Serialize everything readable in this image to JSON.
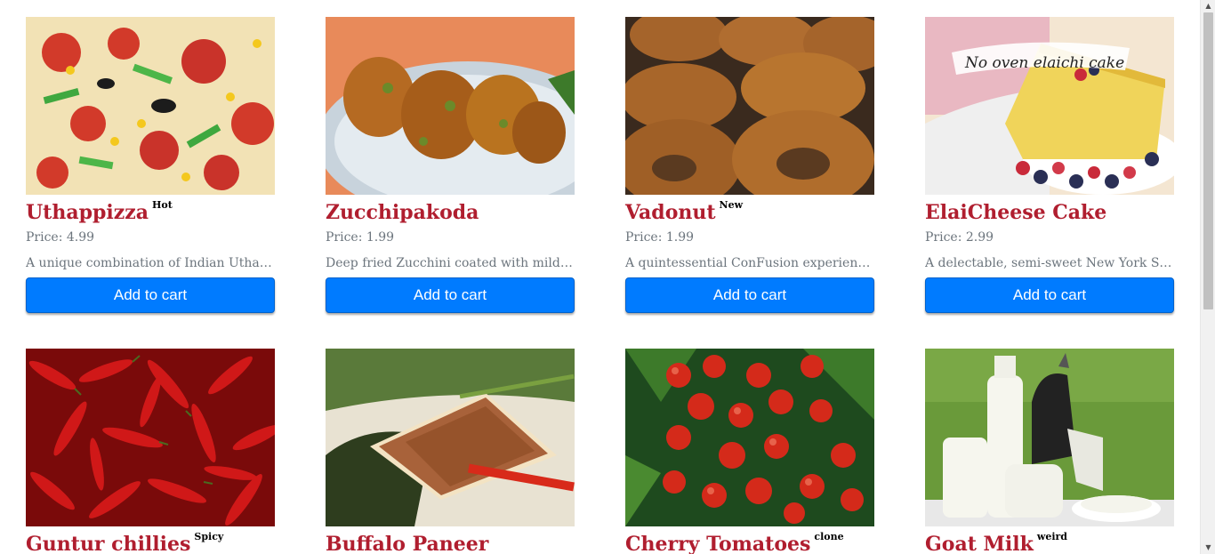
{
  "colors": {
    "title": "#b01e2f",
    "button": "#007bff",
    "muted": "#6c757d"
  },
  "products": [
    {
      "name": "Uthappizza",
      "badge": "Hot",
      "price": "Price: 4.99",
      "description": "A unique combination of Indian Uthappam (pancake) and Italian pizza",
      "button": "Add to cart",
      "image": "pizza"
    },
    {
      "name": "Zucchipakoda",
      "badge": "",
      "price": "Price: 1.99",
      "description": "Deep fried Zucchini coated with mildly spiced Chickpea flour batter",
      "button": "Add to cart",
      "image": "pakoda"
    },
    {
      "name": "Vadonut",
      "badge": "New",
      "price": "Price: 1.99",
      "description": "A quintessential ConFusion experience, is it a vada or is it a donut?",
      "button": "Add to cart",
      "image": "donut"
    },
    {
      "name": "ElaiCheese Cake",
      "badge": "",
      "price": "Price: 2.99",
      "description": "A delectable, semi-sweet New York Style Cheese Cake",
      "button": "Add to cart",
      "image": "cake",
      "image_caption": "No oven elaichi cake"
    },
    {
      "name": "Guntur chillies",
      "badge": "Spicy",
      "image": "chillies"
    },
    {
      "name": "Buffalo Paneer",
      "badge": "",
      "image": "paneer"
    },
    {
      "name": "Cherry Tomatoes",
      "badge": "clone",
      "image": "tomatoes"
    },
    {
      "name": "Goat Milk",
      "badge": "weird",
      "image": "milk"
    }
  ],
  "scrollbar": {
    "up": "▲",
    "down": "▼"
  }
}
